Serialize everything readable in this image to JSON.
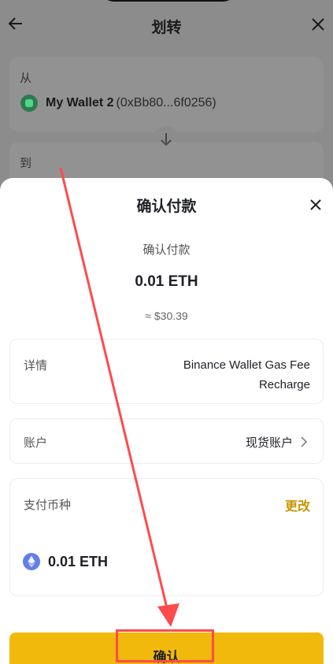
{
  "header": {
    "title": "划转"
  },
  "transfer": {
    "from_label": "从",
    "to_label": "到",
    "wallet_name": "My Wallet 2",
    "wallet_address": "(0xBb80...6f0256)"
  },
  "sheet": {
    "title": "确认付款",
    "sub_label": "确认付款",
    "amount": "0.01 ETH",
    "approx_value": "≈ $30.39",
    "details_label": "详情",
    "details_value": "Binance Wallet Gas Fee Recharge",
    "account_label": "账户",
    "account_value": "现货账户",
    "currency_label": "支付币种",
    "change_label": "更改",
    "currency_amount": "0.01 ETH",
    "confirm_label": "确认"
  },
  "colors": {
    "accent": "#f0b90b",
    "link": "#c99400",
    "annotation": "#ff4b4b",
    "eth": "#627eea"
  }
}
